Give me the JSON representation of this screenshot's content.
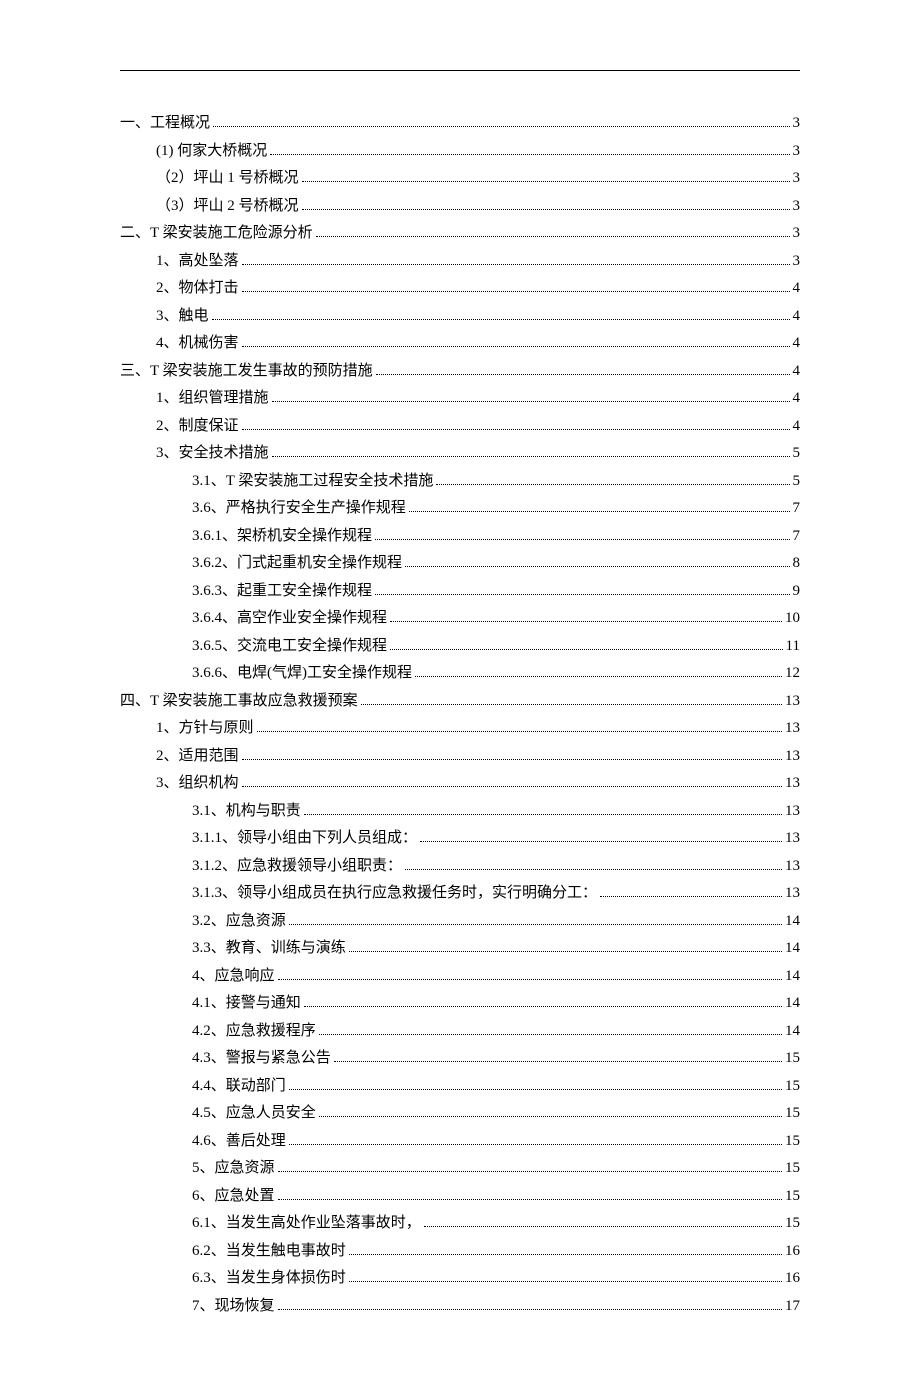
{
  "toc": [
    {
      "level": 0,
      "label": "一、工程概况",
      "page": "3"
    },
    {
      "level": 1,
      "label": "(1) 何家大桥概况",
      "page": "3"
    },
    {
      "level": 1,
      "label": "（2）坪山 1 号桥概况",
      "page": "3"
    },
    {
      "level": 1,
      "label": "（3）坪山 2 号桥概况",
      "page": "3"
    },
    {
      "level": 0,
      "label": "二、T 梁安装施工危险源分析",
      "page": "3"
    },
    {
      "level": 1,
      "label": "1、高处坠落",
      "page": "3"
    },
    {
      "level": 1,
      "label": "2、物体打击",
      "page": "4"
    },
    {
      "level": 1,
      "label": "3、触电",
      "page": "4"
    },
    {
      "level": 1,
      "label": "4、机械伤害",
      "page": "4"
    },
    {
      "level": 0,
      "label": "三、T 梁安装施工发生事故的预防措施",
      "page": "4"
    },
    {
      "level": 1,
      "label": "1、组织管理措施",
      "page": "4"
    },
    {
      "level": 1,
      "label": "2、制度保证",
      "page": "4"
    },
    {
      "level": 1,
      "label": "3、安全技术措施",
      "page": "5"
    },
    {
      "level": 2,
      "label": "3.1、T 梁安装施工过程安全技术措施",
      "page": "5"
    },
    {
      "level": 2,
      "label": "3.6、严格执行安全生产操作规程",
      "page": "7"
    },
    {
      "level": 2,
      "label": "3.6.1、架桥机安全操作规程",
      "page": "7"
    },
    {
      "level": 2,
      "label": "3.6.2、门式起重机安全操作规程",
      "page": "8"
    },
    {
      "level": 2,
      "label": "3.6.3、起重工安全操作规程",
      "page": "9"
    },
    {
      "level": 2,
      "label": "3.6.4、高空作业安全操作规程",
      "page": "10"
    },
    {
      "level": 2,
      "label": "3.6.5、交流电工安全操作规程",
      "page": "11"
    },
    {
      "level": 2,
      "label": "3.6.6、电焊(气焊)工安全操作规程",
      "page": "12"
    },
    {
      "level": 0,
      "label": "四、T 梁安装施工事故应急救援预案",
      "page": "13"
    },
    {
      "level": 1,
      "label": "1、方针与原则",
      "page": "13"
    },
    {
      "level": 1,
      "label": "2、适用范围",
      "page": "13"
    },
    {
      "level": 1,
      "label": "3、组织机构",
      "page": "13"
    },
    {
      "level": 2,
      "label": "3.1、机构与职责",
      "page": "13"
    },
    {
      "level": 2,
      "label": "3.1.1、领导小组由下列人员组成：",
      "page": "13"
    },
    {
      "level": 2,
      "label": "3.1.2、应急救援领导小组职责：",
      "page": "13"
    },
    {
      "level": 2,
      "label": "3.1.3、领导小组成员在执行应急救援任务时，实行明确分工：",
      "page": "13"
    },
    {
      "level": 2,
      "label": "3.2、应急资源",
      "page": "14"
    },
    {
      "level": 2,
      "label": "3.3、教育、训练与演练",
      "page": "14"
    },
    {
      "level": 2,
      "label": "4、应急响应",
      "page": "14"
    },
    {
      "level": 2,
      "label": "4.1、接警与通知",
      "page": "14"
    },
    {
      "level": 2,
      "label": "4.2、应急救援程序",
      "page": "14"
    },
    {
      "level": 2,
      "label": "4.3、警报与紧急公告",
      "page": "15"
    },
    {
      "level": 2,
      "label": "4.4、联动部门",
      "page": "15"
    },
    {
      "level": 2,
      "label": "4.5、应急人员安全",
      "page": "15"
    },
    {
      "level": 2,
      "label": "4.6、善后处理",
      "page": "15"
    },
    {
      "level": 2,
      "label": "5、应急资源",
      "page": "15"
    },
    {
      "level": 2,
      "label": "6、应急处置",
      "page": "15"
    },
    {
      "level": 2,
      "label": "6.1、当发生高处作业坠落事故时，",
      "page": "15"
    },
    {
      "level": 2,
      "label": "6.2、当发生触电事故时",
      "page": "16"
    },
    {
      "level": 2,
      "label": "6.3、当发生身体损伤时",
      "page": "16"
    },
    {
      "level": 2,
      "label": "7、现场恢复",
      "page": "17"
    }
  ]
}
